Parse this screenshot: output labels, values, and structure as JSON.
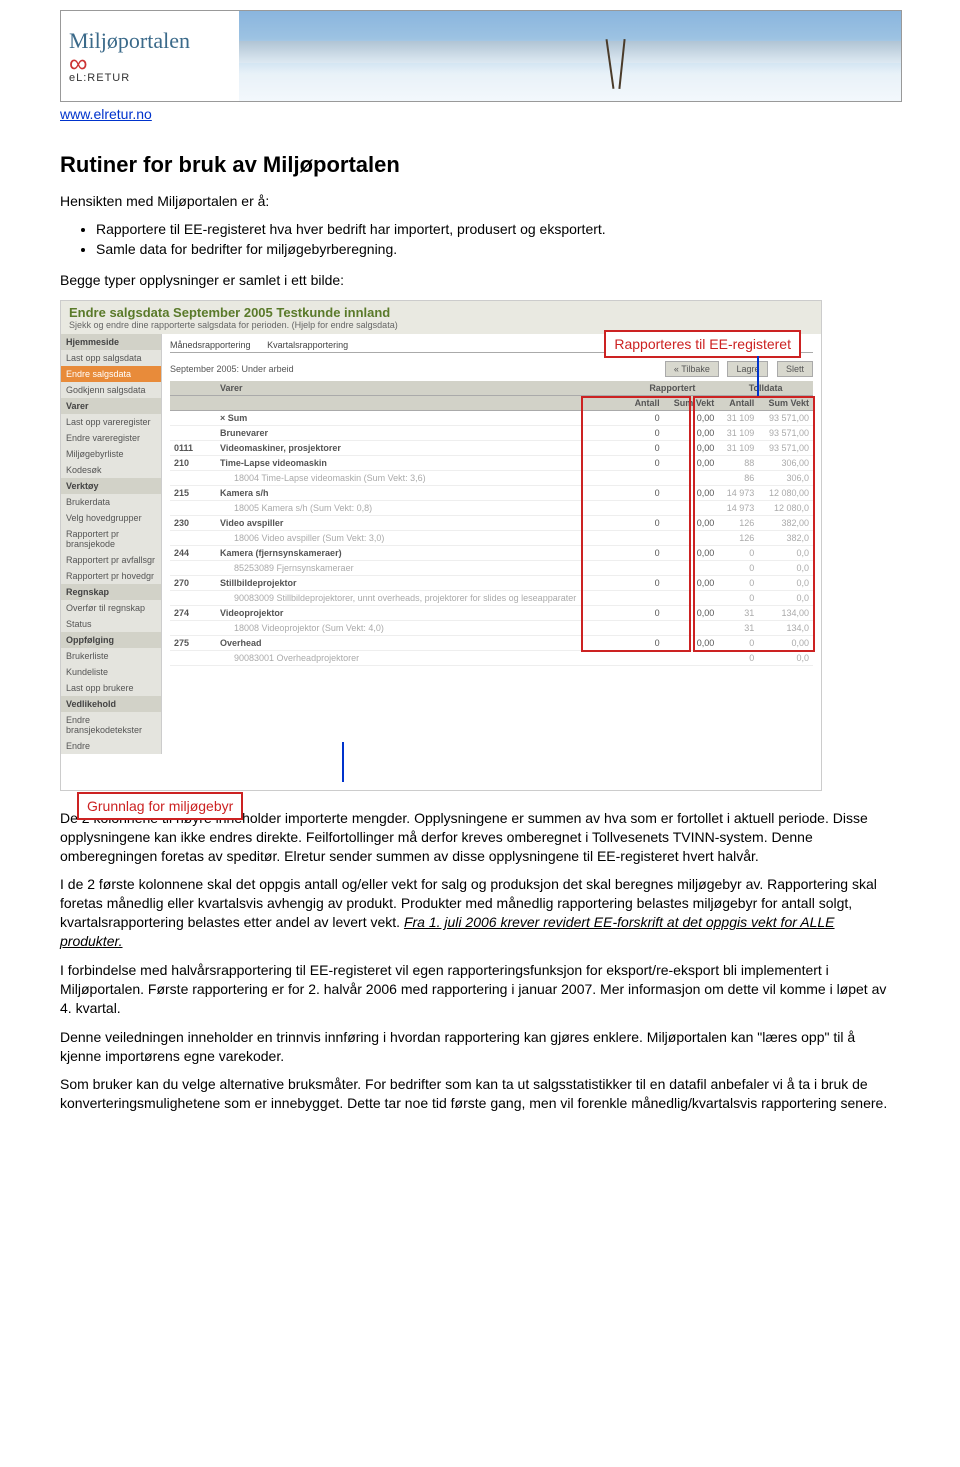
{
  "header": {
    "portal_name": "Miljøportalen",
    "brand_tag": "eL:RETUR",
    "site_link": "www.elretur.no"
  },
  "doc": {
    "title": "Rutiner for bruk av Miljøportalen",
    "intro": "Hensikten med Miljøportalen er å:",
    "bullets": [
      "Rapportere til EE-registeret hva hver bedrift har importert, produsert og eksportert.",
      "Samle data for bedrifter for miljøgebyrberegning."
    ],
    "p_before_shot": "Begge typer opplysninger er samlet i ett bilde:",
    "p_after_shot_1a": "De 2 kolonnene til høyre inneholder importerte mengder. Opplysningene er summen av hva som er fortollet i aktuell periode. Disse opplysningene kan ikke endres direkte. Feilfortollinger må derfor kreves omberegnet i Tollvesenets TVINN-system. Denne omberegningen foretas av speditør. Elretur sender summen av disse opplysningene til EE-registeret hvert halvår.",
    "p_after_shot_2a": "I de 2 første kolonnene skal det oppgis antall og/eller vekt for salg og produksjon det skal beregnes miljøgebyr av. Rapportering skal foretas månedlig eller kvartalsvis avhengig av produkt. Produkter med månedlig rapportering belastes miljøgebyr for antall solgt, kvartalsrapportering belastes etter andel av levert vekt. ",
    "p_after_shot_2b": "Fra 1. juli 2006 krever revidert EE-forskrift at det oppgis vekt for ALLE produkter.",
    "p_after_shot_3": "I forbindelse med halvårsrapportering til EE-registeret vil egen rapporteringsfunksjon for eksport/re-eksport bli implementert i Miljøportalen. Første rapportering er for 2. halvår 2006 med rapportering i januar 2007. Mer informasjon om dette vil komme i løpet av 4. kvartal.",
    "p_after_shot_4": "Denne veiledningen inneholder en trinnvis innføring i hvordan rapportering kan gjøres enklere. Miljøportalen kan \"læres opp\" til å kjenne importørens egne varekoder.",
    "p_after_shot_5": "Som bruker kan du velge alternative bruksmåter. For bedrifter som kan ta ut salgsstatistikker til en datafil anbefaler vi å ta i bruk de konverteringsmulighetene som er innebygget. Dette tar noe tid første gang, men vil forenkle månedlig/kvartalsvis rapportering senere."
  },
  "shot": {
    "page_title": "Endre salgsdata   September 2005   Testkunde innland",
    "page_sub": "Sjekk og endre dine rapporterte salgsdata for perioden.  (Hjelp for endre salgsdata)",
    "side_groups": [
      {
        "h": "Hjemmeside",
        "items": []
      },
      {
        "h": "",
        "items": [
          "Last opp salgsdata",
          "Endre salgsdata",
          "Godkjenn salgsdata"
        ]
      },
      {
        "h": "Varer",
        "items": [
          "Last opp vareregister",
          "Endre vareregister",
          "Miljøgebyrliste",
          "Kodesøk"
        ]
      },
      {
        "h": "Verktøy",
        "items": [
          "Brukerdata",
          "Velg hovedgrupper",
          "Rapportert pr bransjekode",
          "Rapportert pr avfallsgr",
          "Rapportert pr hovedgr"
        ]
      },
      {
        "h": "Regnskap",
        "items": [
          "Overfør til regnskap",
          "Status"
        ]
      },
      {
        "h": "Oppfølging",
        "items": [
          "Brukerliste",
          "Kundeliste",
          "Last opp brukere"
        ]
      },
      {
        "h": "Vedlikehold",
        "items": [
          "Endre bransjekodetekster",
          "Endre"
        ]
      }
    ],
    "tabs": [
      "Månedsrapportering",
      "Kvartalsrapportering"
    ],
    "period": "September 2005: Under arbeid",
    "btn_back": "« Tilbake",
    "btn_save": "Lagre",
    "btn_del": "Slett",
    "th_varer": "Varer",
    "th_rapp": "Rapportert",
    "th_toll": "Tolldata",
    "th_antall": "Antall",
    "th_sum": "Sum Vekt",
    "rows": [
      {
        "code": "",
        "name": "× Sum",
        "b": true,
        "a": "0",
        "v": "0,00",
        "ta": "31 109",
        "tv": "93 571,00"
      },
      {
        "code": "",
        "name": "Brunevarer",
        "b": true,
        "a": "0",
        "v": "0,00",
        "ta": "31 109",
        "tv": "93 571,00"
      },
      {
        "code": "0111",
        "name": "Videomaskiner, prosjektorer",
        "b": true,
        "a": "0",
        "v": "0,00",
        "ta": "31 109",
        "tv": "93 571,00"
      },
      {
        "code": "210",
        "name": "Time-Lapse videomaskin",
        "b": true,
        "a": "0",
        "v": "0,00",
        "ta": "88",
        "tv": "306,00"
      },
      {
        "code": "",
        "name": "18004 Time-Lapse videomaskin  (Sum Vekt: 3,6)",
        "b": false,
        "a": "",
        "v": "",
        "ta": "86",
        "tv": "306,0"
      },
      {
        "code": "215",
        "name": "Kamera s/h",
        "b": true,
        "a": "0",
        "v": "0,00",
        "ta": "14 973",
        "tv": "12 080,00"
      },
      {
        "code": "",
        "name": "18005 Kamera s/h  (Sum Vekt: 0,8)",
        "b": false,
        "a": "",
        "v": "",
        "ta": "14 973",
        "tv": "12 080,0"
      },
      {
        "code": "230",
        "name": "Video avspiller",
        "b": true,
        "a": "0",
        "v": "0,00",
        "ta": "126",
        "tv": "382,00"
      },
      {
        "code": "",
        "name": "18006 Video avspiller  (Sum Vekt: 3,0)",
        "b": false,
        "a": "",
        "v": "",
        "ta": "126",
        "tv": "382,0"
      },
      {
        "code": "244",
        "name": "Kamera (fjernsynskameraer)",
        "b": true,
        "a": "0",
        "v": "0,00",
        "ta": "0",
        "tv": "0,0"
      },
      {
        "code": "",
        "name": "85253089  Fjernsynskameraer",
        "b": false,
        "a": "",
        "v": "",
        "ta": "0",
        "tv": "0,0"
      },
      {
        "code": "270",
        "name": "Stillbildeprojektor",
        "b": true,
        "a": "0",
        "v": "0,00",
        "ta": "0",
        "tv": "0,0"
      },
      {
        "code": "",
        "name": "90083009  Stillbildeprojektorer, unnt overheads, projektorer for slides og leseapparater",
        "b": false,
        "a": "",
        "v": "",
        "ta": "0",
        "tv": "0,0"
      },
      {
        "code": "274",
        "name": "Videoprojektor",
        "b": true,
        "a": "0",
        "v": "0,00",
        "ta": "31",
        "tv": "134,00"
      },
      {
        "code": "",
        "name": "18008  Videoprojektor  (Sum Vekt: 4,0)",
        "b": false,
        "a": "",
        "v": "",
        "ta": "31",
        "tv": "134,0"
      },
      {
        "code": "275",
        "name": "Overhead",
        "b": true,
        "a": "0",
        "v": "0,00",
        "ta": "0",
        "tv": "0,00"
      },
      {
        "code": "",
        "name": "90083001  Overheadprojektorer",
        "b": false,
        "a": "",
        "v": "",
        "ta": "0",
        "tv": "0,0"
      }
    ],
    "callout_top": "Rapporteres til EE-registeret",
    "callout_bot": "Grunnlag for miljøgebyr"
  }
}
